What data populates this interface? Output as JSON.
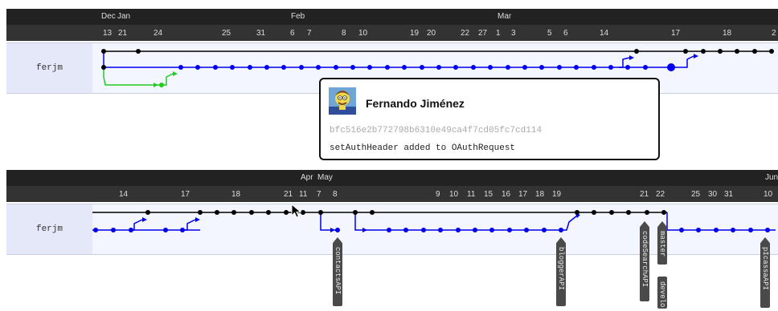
{
  "user": "ferjm",
  "panel1": {
    "months": [
      "Dec",
      "Jan",
      "Feb",
      "Mar"
    ],
    "days": [
      "13",
      "21",
      "24",
      "25",
      "31",
      "6",
      "7",
      "8",
      "10",
      "19",
      "20",
      "22",
      "27",
      "1",
      "3",
      "5",
      "6",
      "14",
      "17",
      "18",
      "2"
    ]
  },
  "panel2": {
    "months": [
      "Apr",
      "May",
      "Jun"
    ],
    "days": [
      "14",
      "17",
      "18",
      "21",
      "11",
      "7",
      "8",
      "9",
      "10",
      "11",
      "15",
      "16",
      "17",
      "18",
      "19",
      "21",
      "22",
      "25",
      "30",
      "31",
      "10"
    ],
    "branch_tags": [
      "contactsAPI",
      "bloggerAPI",
      "codeSearchAPI",
      "master",
      "pIcassaAPI",
      "develo"
    ]
  },
  "popup": {
    "author": "Fernando Jiménez",
    "hash": "bfc516e2b772798b6310e49ca4f7cd05fc7cd114",
    "message": "setAuthHeader added to OAuthRequest"
  },
  "colors": {
    "main": "#000000",
    "branch": "#0000ee",
    "feature": "#22cc22",
    "header": "#222222"
  },
  "icons": [
    "avatar-icon",
    "cursor-icon"
  ]
}
